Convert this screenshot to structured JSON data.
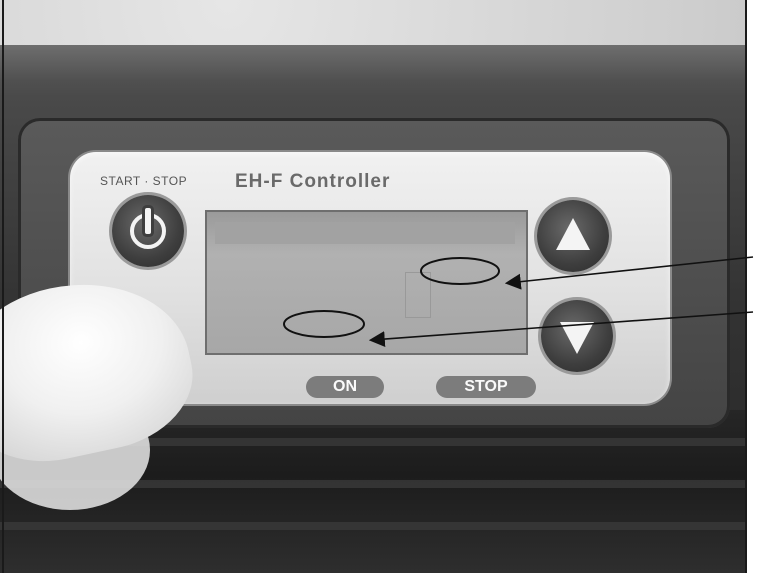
{
  "panel": {
    "start_stop_label": "START · STOP",
    "title": "EH-F Controller"
  },
  "buttons": {
    "on_label": "ON",
    "stop_label": "STOP",
    "power_icon": "power-icon",
    "up_icon": "arrow-up-icon",
    "down_icon": "arrow-down-icon"
  },
  "colors": {
    "panel": "#e4e4e4",
    "housing": "#3a3a3a",
    "lcd": "#a8a8a8",
    "annotation": "#111111"
  }
}
